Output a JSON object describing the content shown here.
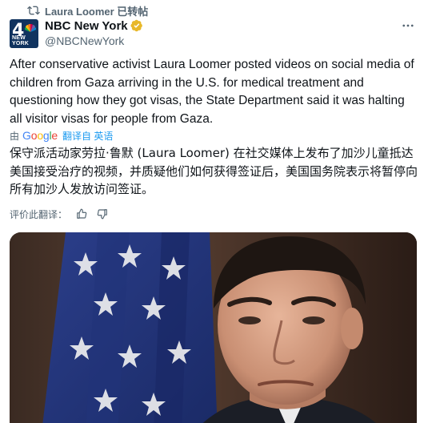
{
  "repost": {
    "icon": "repost-icon",
    "label": "Laura Loomer 已转帖"
  },
  "author": {
    "avatar": {
      "number": "4",
      "caption": "NEW YORK",
      "brand_colors": [
        "#10335f",
        "#ffffff"
      ]
    },
    "name": "NBC New York",
    "handle": "@NBCNewYork",
    "verified_icon": "verified-gold-badge-icon",
    "verified_color": "#e8b829"
  },
  "menu": {
    "icon": "more-horizontal-icon",
    "label": "···"
  },
  "tweet": {
    "text": "After conservative activist Laura Loomer posted videos on social media of children from Gaza arriving in the U.S. for medical treatment and questioning how they got visas, the State Department said it was halting all visitor visas for people from Gaza."
  },
  "translation": {
    "by_label": "由",
    "provider_logo_text": "Google",
    "action_label": "翻译自 英语",
    "text": "保守派活动家劳拉·鲁默 (Laura Loomer) 在社交媒体上发布了加沙儿童抵达美国接受治疗的视频，并质疑他们如何获得签证后，美国国务院表示将暂停向所有加沙人发放访问签证。",
    "link_color": "#1d9bf0"
  },
  "rating": {
    "label": "评价此翻译：",
    "thumbs_up_icon": "thumbs-up-icon",
    "thumbs_down_icon": "thumbs-down-icon"
  },
  "media": {
    "icon": "photo-man-in-front-of-flag"
  }
}
